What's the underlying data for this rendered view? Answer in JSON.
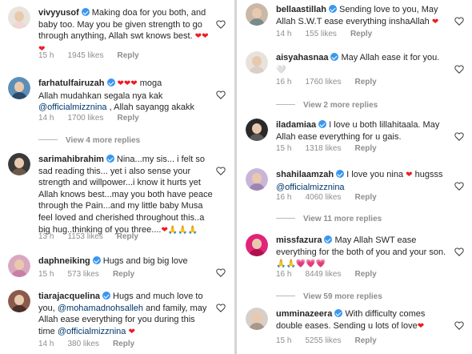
{
  "left": [
    {
      "username": "vivyyusof",
      "verified": true,
      "parts": [
        [
          "text",
          "Making doa for you both, and baby too. May you be given strength to go through anything, Allah swt knows best. "
        ],
        [
          "heart",
          "❤"
        ],
        [
          "heart",
          "❤❤"
        ]
      ],
      "time": "15 h",
      "likes": "1945 likes",
      "reply": "Reply"
    },
    {
      "username": "farhatulfairuzah",
      "verified": true,
      "parts": [
        [
          "heart",
          "❤❤❤"
        ],
        [
          "text",
          " moga"
        ],
        [
          "br",
          ""
        ],
        [
          "text",
          "Allah mudahkan segala nya kak "
        ],
        [
          "mention",
          "@officialmizznina"
        ],
        [
          "text",
          " , Allah sayangg akakk"
        ]
      ],
      "time": "14 h",
      "likes": "1700 likes",
      "reply": "Reply",
      "view_more": "View 4 more replies"
    },
    {
      "username": "sarimahibrahim",
      "verified": true,
      "parts": [
        [
          "text",
          "Nina...my sis... i felt so sad reading this... yet i also sense your strength and willpower...i know it hurts yet Allah knows best...may you both have peace through the Pain...and my little baby Musa feel loved and cherished throughout this..a big hug..thinking of you three...."
        ],
        [
          "heart",
          "❤"
        ],
        [
          "hands",
          "🙏🙏🙏"
        ]
      ],
      "time": "13 h",
      "likes": "1153 likes",
      "reply": "Reply"
    },
    {
      "username": "daphneiking",
      "verified": true,
      "parts": [
        [
          "text",
          "Hugs and big big love"
        ]
      ],
      "time": "15 h",
      "likes": "573 likes",
      "reply": "Reply"
    },
    {
      "username": "tiarajacquelina",
      "verified": true,
      "parts": [
        [
          "text",
          "Hugs and much love to you, "
        ],
        [
          "mention",
          "@mohamadnohsalleh"
        ],
        [
          "text",
          " and family, may Allah ease everything for you during this time "
        ],
        [
          "mention",
          "@officialmizznina"
        ],
        [
          "text",
          " "
        ],
        [
          "heart",
          "❤"
        ]
      ],
      "time": "14 h",
      "likes": "380 likes",
      "reply": "Reply"
    }
  ],
  "right": [
    {
      "username": "bellaastillah",
      "verified": true,
      "parts": [
        [
          "text",
          "Sending love to you, May Allah S.W.T ease everything inshaAllah "
        ],
        [
          "heart",
          "❤"
        ]
      ],
      "time": "14 h",
      "likes": "155 likes",
      "reply": "Reply"
    },
    {
      "username": "aisyahasnaa",
      "verified": true,
      "parts": [
        [
          "text",
          "May Allah ease it for you. "
        ],
        [
          "white",
          "🤍"
        ]
      ],
      "time": "16 h",
      "likes": "1760 likes",
      "reply": "Reply",
      "view_more": "View 2 more replies"
    },
    {
      "username": "iladamiaa",
      "verified": true,
      "parts": [
        [
          "text",
          "I love u both lillahitaala. May Allah ease everything for u gais."
        ]
      ],
      "time": "15 h",
      "likes": "1318 likes",
      "reply": "Reply"
    },
    {
      "username": "shahilaamzah",
      "verified": true,
      "parts": [
        [
          "text",
          "I love you nina "
        ],
        [
          "heart",
          "❤"
        ],
        [
          "text",
          " hugsss "
        ],
        [
          "mention",
          "@officialmizznina"
        ]
      ],
      "time": "16 h",
      "likes": "4060 likes",
      "reply": "Reply",
      "view_more": "View 11 more replies"
    },
    {
      "username": "missfazura",
      "verified": true,
      "parts": [
        [
          "text",
          "May Allah SWT ease everything for the both of you and your son. "
        ],
        [
          "hands",
          "🙏🙏"
        ],
        [
          "heart",
          "💗💗💗"
        ]
      ],
      "time": "16 h",
      "likes": "8449 likes",
      "reply": "Reply",
      "view_more": "View 59 more replies"
    },
    {
      "username": "umminazeera",
      "verified": true,
      "parts": [
        [
          "text",
          "With difficulty comes double eases. Sending u lots of love"
        ],
        [
          "heart",
          "❤"
        ]
      ],
      "time": "15 h",
      "likes": "5255 likes",
      "reply": "Reply"
    }
  ],
  "colors": {
    "verified": "#3897f0",
    "mention": "#00376b",
    "meta": "#8e8e8e",
    "heart": "#ed1c24"
  }
}
